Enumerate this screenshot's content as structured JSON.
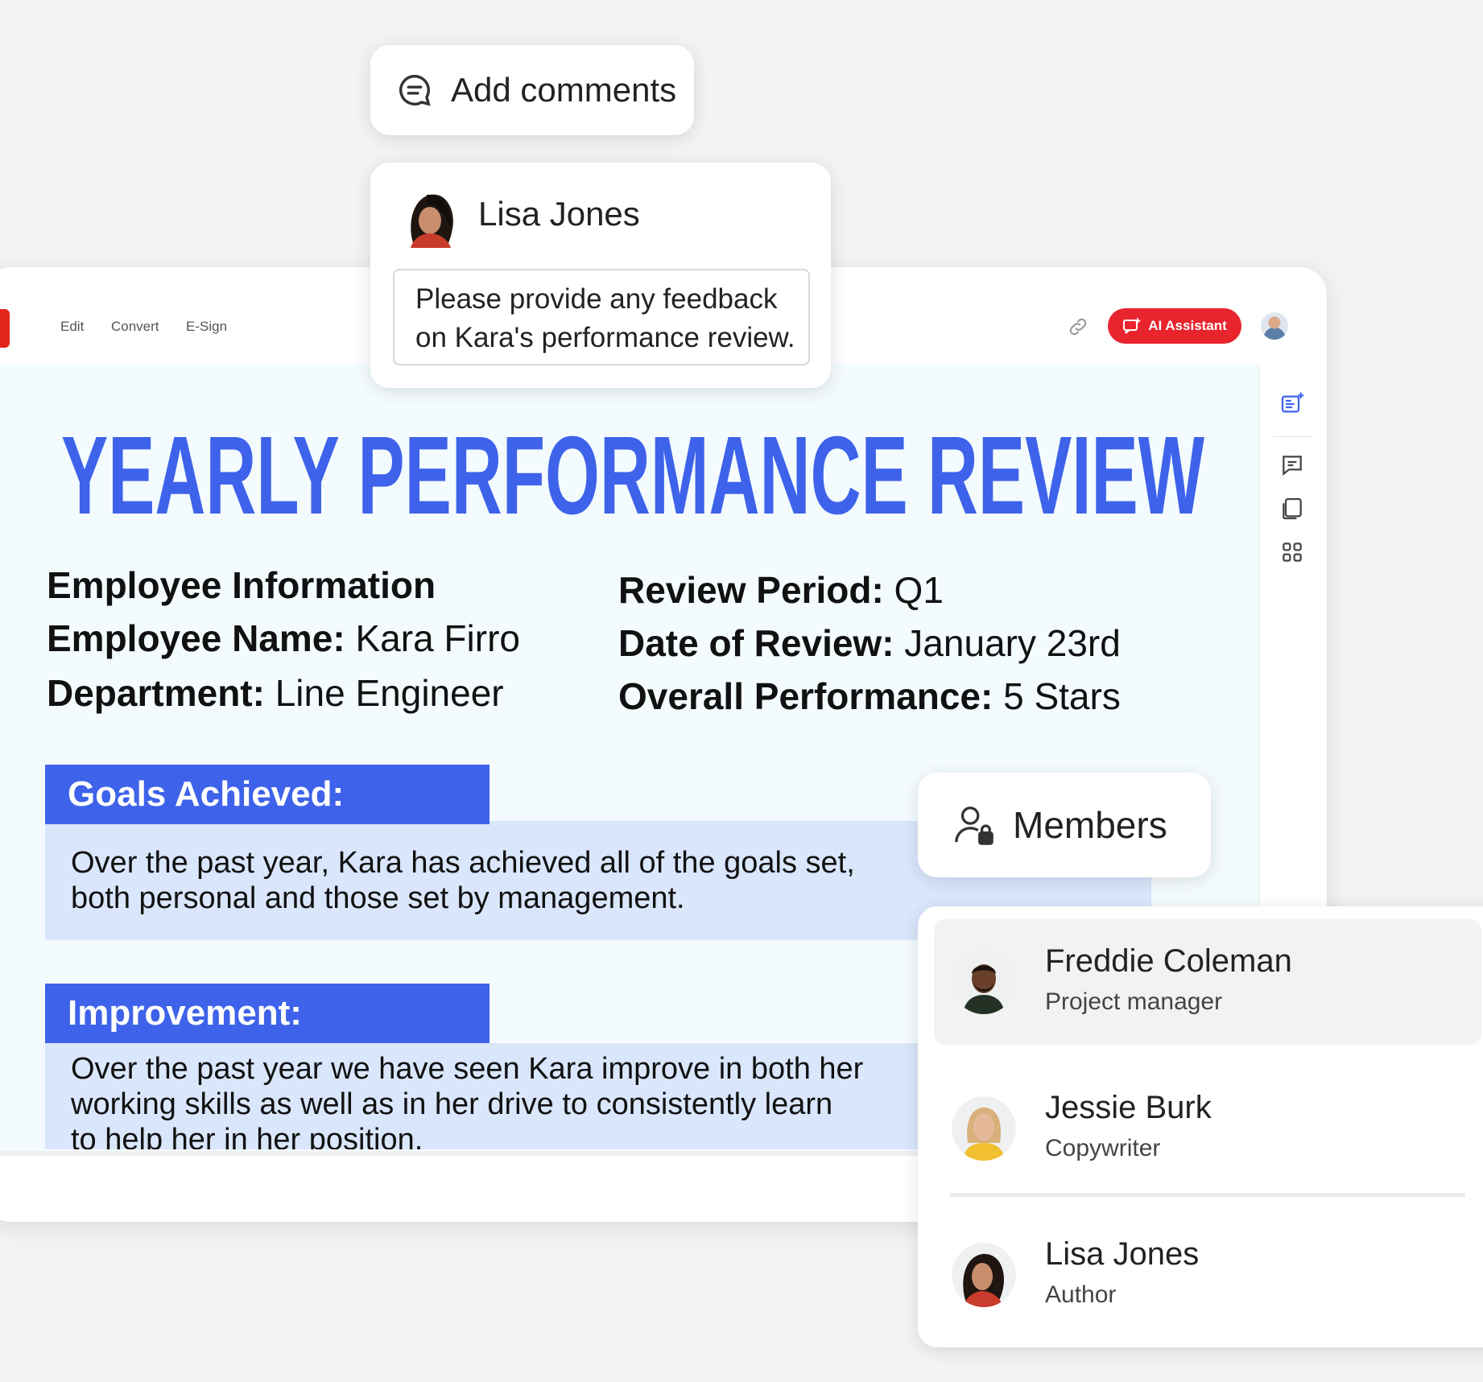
{
  "toolbar": {
    "menu": [
      "Edit",
      "Convert",
      "E-Sign"
    ],
    "ai_button_label": "AI Assistant",
    "accent_color": "#e8242d"
  },
  "comment_popup": {
    "add_comments_label": "Add comments",
    "author": "Lisa Jones",
    "text_line1": "Please provide any feedback",
    "text_line2": "on Kara's performance review."
  },
  "document": {
    "title": "YEARLY PERFORMANCE REVIEW",
    "title_color": "#3e63ea",
    "left_info": {
      "heading": "Employee Information",
      "name_label": "Employee Name:",
      "name_value": " Kara Firro",
      "department_label": "Department:",
      "department_value": " Line Engineer"
    },
    "right_info": {
      "period_label": "Review Period:",
      "period_value": " Q1",
      "date_label": "Date of Review:",
      "date_value": " January 23rd",
      "overall_label": "Overall Performance:",
      "overall_value": " 5 Stars"
    },
    "goals": {
      "header": "Goals Achieved:",
      "line1": "Over the past year, Kara has achieved all of the goals set,",
      "line2": "both personal and those set by management."
    },
    "improvement": {
      "header": "Improvement:",
      "line1": "Over the past year we have seen Kara improve in both her",
      "line2": "working skills as well as in her drive to consistently learn",
      "line3": "to help her in her position."
    }
  },
  "members": {
    "label": "Members",
    "list": [
      {
        "name": "Freddie Coleman",
        "role": "Project manager"
      },
      {
        "name": "Jessie Burk",
        "role": "Copywriter"
      },
      {
        "name": "Lisa Jones",
        "role": "Author"
      }
    ]
  }
}
